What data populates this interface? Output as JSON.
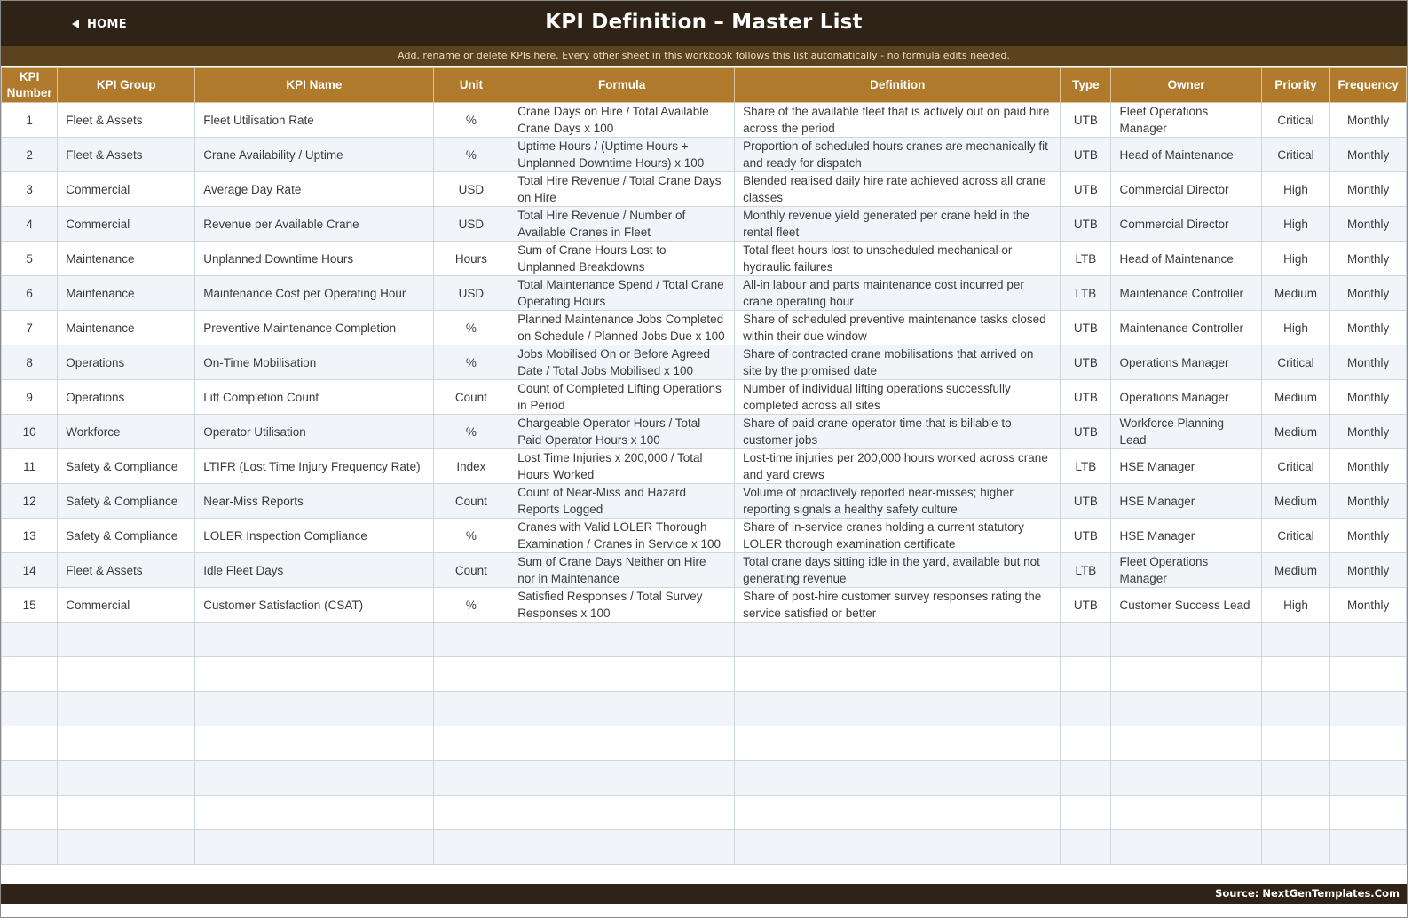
{
  "header": {
    "home_label": "HOME",
    "title": "KPI Definition  –  Master List",
    "subtitle": "Add, rename or delete KPIs here. Every other sheet in this workbook follows this list automatically - no formula edits needed."
  },
  "table": {
    "columns": [
      "KPI Number",
      "KPI Group",
      "KPI Name",
      "Unit",
      "Formula",
      "Definition",
      "Type",
      "Owner",
      "Priority",
      "Frequency"
    ],
    "rows": [
      [
        "1",
        "Fleet & Assets",
        "Fleet Utilisation Rate",
        "%",
        "Crane Days on Hire / Total Available Crane Days x 100",
        "Share of the available fleet that is actively out on paid hire across the period",
        "UTB",
        "Fleet Operations Manager",
        "Critical",
        "Monthly"
      ],
      [
        "2",
        "Fleet & Assets",
        "Crane Availability / Uptime",
        "%",
        "Uptime Hours / (Uptime Hours + Unplanned Downtime Hours) x 100",
        "Proportion of scheduled hours cranes are mechanically fit and ready for dispatch",
        "UTB",
        "Head of Maintenance",
        "Critical",
        "Monthly"
      ],
      [
        "3",
        "Commercial",
        "Average Day Rate",
        "USD",
        "Total Hire Revenue / Total Crane Days on Hire",
        "Blended realised daily hire rate achieved across all crane classes",
        "UTB",
        "Commercial Director",
        "High",
        "Monthly"
      ],
      [
        "4",
        "Commercial",
        "Revenue per Available Crane",
        "USD",
        "Total Hire Revenue / Number of Available Cranes in Fleet",
        "Monthly revenue yield generated per crane held in the rental fleet",
        "UTB",
        "Commercial Director",
        "High",
        "Monthly"
      ],
      [
        "5",
        "Maintenance",
        "Unplanned Downtime Hours",
        "Hours",
        "Sum of Crane Hours Lost to Unplanned Breakdowns",
        "Total fleet hours lost to unscheduled mechanical or hydraulic failures",
        "LTB",
        "Head of Maintenance",
        "High",
        "Monthly"
      ],
      [
        "6",
        "Maintenance",
        "Maintenance Cost per Operating Hour",
        "USD",
        "Total Maintenance Spend / Total Crane Operating Hours",
        "All-in labour and parts maintenance cost incurred per crane operating hour",
        "LTB",
        "Maintenance Controller",
        "Medium",
        "Monthly"
      ],
      [
        "7",
        "Maintenance",
        "Preventive Maintenance Completion",
        "%",
        "Planned Maintenance Jobs Completed on Schedule / Planned Jobs Due x 100",
        "Share of scheduled preventive maintenance tasks closed within their due window",
        "UTB",
        "Maintenance Controller",
        "High",
        "Monthly"
      ],
      [
        "8",
        "Operations",
        "On-Time Mobilisation",
        "%",
        "Jobs Mobilised On or Before Agreed Date / Total Jobs Mobilised x 100",
        "Share of contracted crane mobilisations that arrived on site by the promised date",
        "UTB",
        "Operations Manager",
        "Critical",
        "Monthly"
      ],
      [
        "9",
        "Operations",
        "Lift Completion Count",
        "Count",
        "Count of Completed Lifting Operations in Period",
        "Number of individual lifting operations successfully completed across all sites",
        "UTB",
        "Operations Manager",
        "Medium",
        "Monthly"
      ],
      [
        "10",
        "Workforce",
        "Operator Utilisation",
        "%",
        "Chargeable Operator Hours / Total Paid Operator Hours x 100",
        "Share of paid crane-operator time that is billable to customer jobs",
        "UTB",
        "Workforce Planning Lead",
        "Medium",
        "Monthly"
      ],
      [
        "11",
        "Safety & Compliance",
        "LTIFR (Lost Time Injury Frequency Rate)",
        "Index",
        "Lost Time Injuries x 200,000 / Total Hours Worked",
        "Lost-time injuries per 200,000 hours worked across crane and yard crews",
        "LTB",
        "HSE Manager",
        "Critical",
        "Monthly"
      ],
      [
        "12",
        "Safety & Compliance",
        "Near-Miss Reports",
        "Count",
        "Count of Near-Miss and Hazard Reports Logged",
        "Volume of proactively reported near-misses; higher reporting signals a healthy safety culture",
        "UTB",
        "HSE Manager",
        "Medium",
        "Monthly"
      ],
      [
        "13",
        "Safety & Compliance",
        "LOLER Inspection Compliance",
        "%",
        "Cranes with Valid LOLER Thorough Examination / Cranes in Service x 100",
        "Share of in-service cranes holding a current statutory LOLER thorough examination certificate",
        "UTB",
        "HSE Manager",
        "Critical",
        "Monthly"
      ],
      [
        "14",
        "Fleet & Assets",
        "Idle Fleet Days",
        "Count",
        "Sum of Crane Days Neither on Hire nor in Maintenance",
        "Total crane days sitting idle in the yard, available but not generating revenue",
        "LTB",
        "Fleet Operations Manager",
        "Medium",
        "Monthly"
      ],
      [
        "15",
        "Commercial",
        "Customer Satisfaction (CSAT)",
        "%",
        "Satisfied Responses / Total Survey Responses x 100",
        "Share of post-hire customer survey responses rating the service satisfied or better",
        "UTB",
        "Customer Success Lead",
        "High",
        "Monthly"
      ]
    ],
    "empty_row_count": 7
  },
  "footer": {
    "source": "Source: NextGenTemplates.Com"
  }
}
